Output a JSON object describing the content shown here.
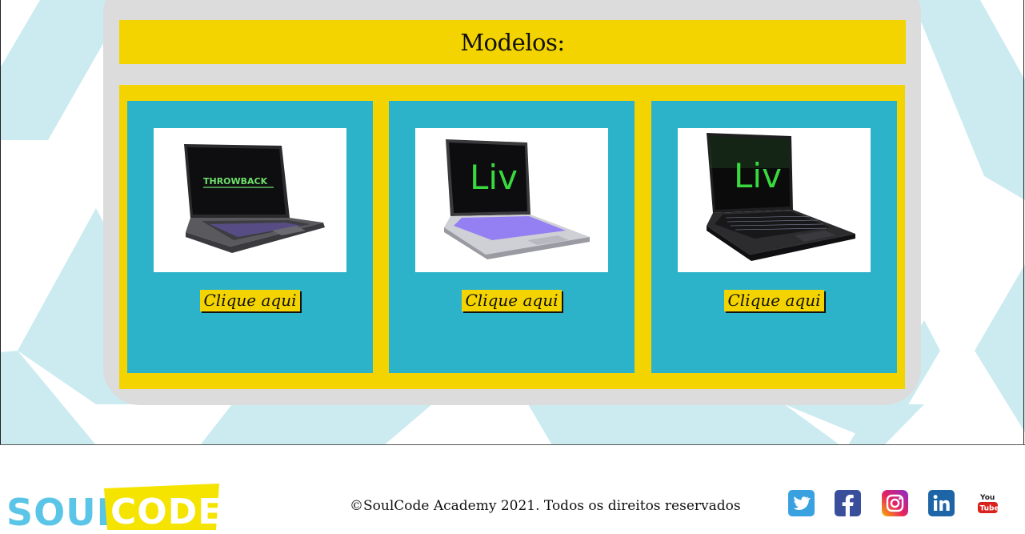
{
  "section": {
    "title": "Modelos:"
  },
  "models": [
    {
      "button_label": "Clique aqui",
      "screen_text": "THROWBACK",
      "screen_color": "#6fe06a",
      "body_color": "#5a5a5e",
      "keys_color": "#8a6cff"
    },
    {
      "button_label": "Clique aqui",
      "screen_text": "Liv",
      "screen_color": "#39d83c",
      "body_color": "#cfd0d6",
      "keys_color": "#7a5cff"
    },
    {
      "button_label": "Clique aqui",
      "screen_text": "Liv",
      "screen_color": "#39d83c",
      "body_color": "#2c2c2e",
      "keys_color": "#cfd8ff"
    }
  ],
  "footer": {
    "logo": {
      "part1": "SOUL",
      "part2": "CODE"
    },
    "copyright": "©SoulCode Academy 2021. Todos os direitos reservados",
    "social": [
      "twitter-icon",
      "facebook-icon",
      "instagram-icon",
      "linkedin-icon",
      "youtube-icon"
    ]
  },
  "colors": {
    "accent_yellow": "#f4d400",
    "card_teal": "#2db3c9",
    "panel_gray": "#dcdcdc",
    "pattern_blue": "#cbebf0",
    "logo_blue": "#5bc5e8"
  }
}
